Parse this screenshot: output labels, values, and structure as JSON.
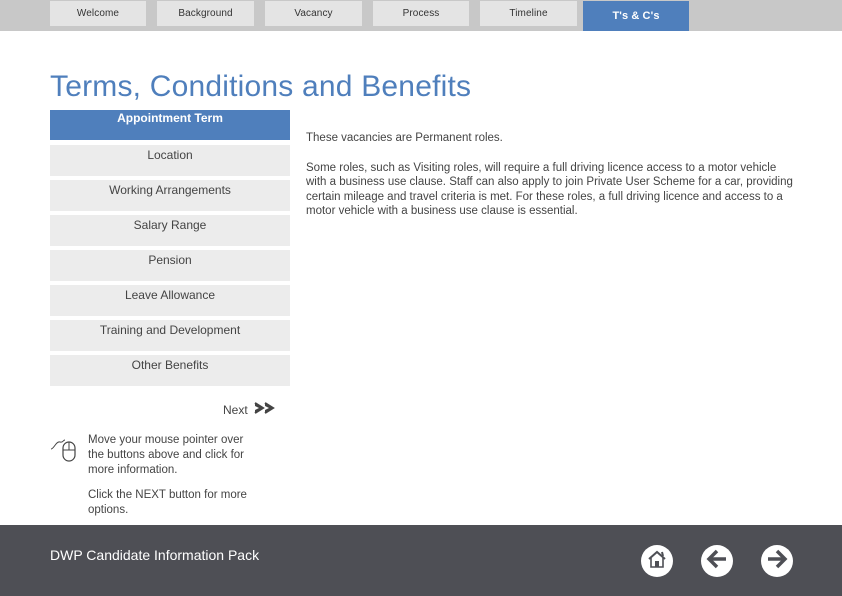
{
  "nav": {
    "tabs": [
      {
        "label": "Welcome"
      },
      {
        "label": "Background"
      },
      {
        "label": "Vacancy"
      },
      {
        "label": "Process"
      },
      {
        "label": "Timeline"
      },
      {
        "label": "T's & C's",
        "active": true
      }
    ]
  },
  "page": {
    "title": "Terms, Conditions and Benefits"
  },
  "menu": {
    "items": [
      {
        "label": "Appointment Term",
        "active": true
      },
      {
        "label": "Location"
      },
      {
        "label": "Working Arrangements"
      },
      {
        "label": "Salary Range"
      },
      {
        "label": "Pension"
      },
      {
        "label": "Leave Allowance"
      },
      {
        "label": "Training and Development"
      },
      {
        "label": "Other Benefits"
      }
    ]
  },
  "content": {
    "paragraphs": [
      "These vacancies are Permanent roles.",
      "Some roles, such as Visiting roles, will require a full driving licence access to a motor vehicle with a business use clause. Staff can also apply to join Private User Scheme for a car, providing certain mileage and travel criteria is met. For these roles, a full driving licence and access to a motor vehicle with a business use clause is essential."
    ]
  },
  "next": {
    "label": "Next",
    "icon": "double-chevron-right-icon",
    "glyph": ">>"
  },
  "hints": {
    "icon": "mouse-icon",
    "hover_hint": "Move your mouse pointer over the buttons above and click for more information.",
    "next_hint": "Click the NEXT button for more options."
  },
  "footer": {
    "title": "DWP Candidate Information Pack",
    "buttons": [
      {
        "name": "home",
        "icon": "home-icon"
      },
      {
        "name": "back",
        "icon": "arrow-left-icon"
      },
      {
        "name": "forward",
        "icon": "arrow-right-icon"
      }
    ]
  },
  "colors": {
    "accent": "#4f7fbc",
    "nav_bg": "#c8c8c8",
    "tab_bg": "#e4e4e4",
    "menu_bg": "#ececec",
    "footer_bg": "#4e4f55"
  }
}
